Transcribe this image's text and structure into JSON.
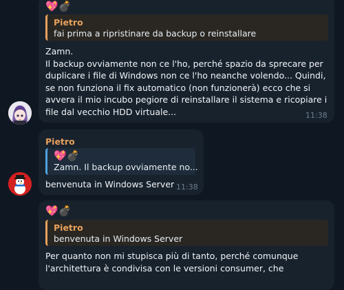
{
  "messages": [
    {
      "reactions": "💖💣",
      "reply": {
        "sender": "Pietro",
        "text": "fai prima a ripristinare da backup o reinstallare"
      },
      "text": "Zamn.\nIl backup ovviamente non ce l'ho, perché spazio da sprecare per duplicare i file di Windows non ce l'ho neanche volendo... Quindi, se non funziona il fix automatico (non funzionerà) ecco che si avvera il mio incubo pegiore di reinstallare il sistema e ricopiare i file dal vecchio HDD virtuale...",
      "time": "11:38",
      "avatar": "anime-avatar"
    },
    {
      "sender": "Pietro",
      "reply": {
        "reactions": "💖💣",
        "text": "Zamn. Il backup ovviamente no..."
      },
      "text": "benvenuta in Windows Server",
      "time": "11:38",
      "avatar": "snowman-avatar"
    },
    {
      "reactions": "💖💣",
      "reply": {
        "sender": "Pietro",
        "text": "benvenuta in Windows Server"
      },
      "text": "Per quanto non mi stupisca più di tanto, perché comunque\nl'architettura è condivisa con le versioni consumer, che"
    }
  ]
}
